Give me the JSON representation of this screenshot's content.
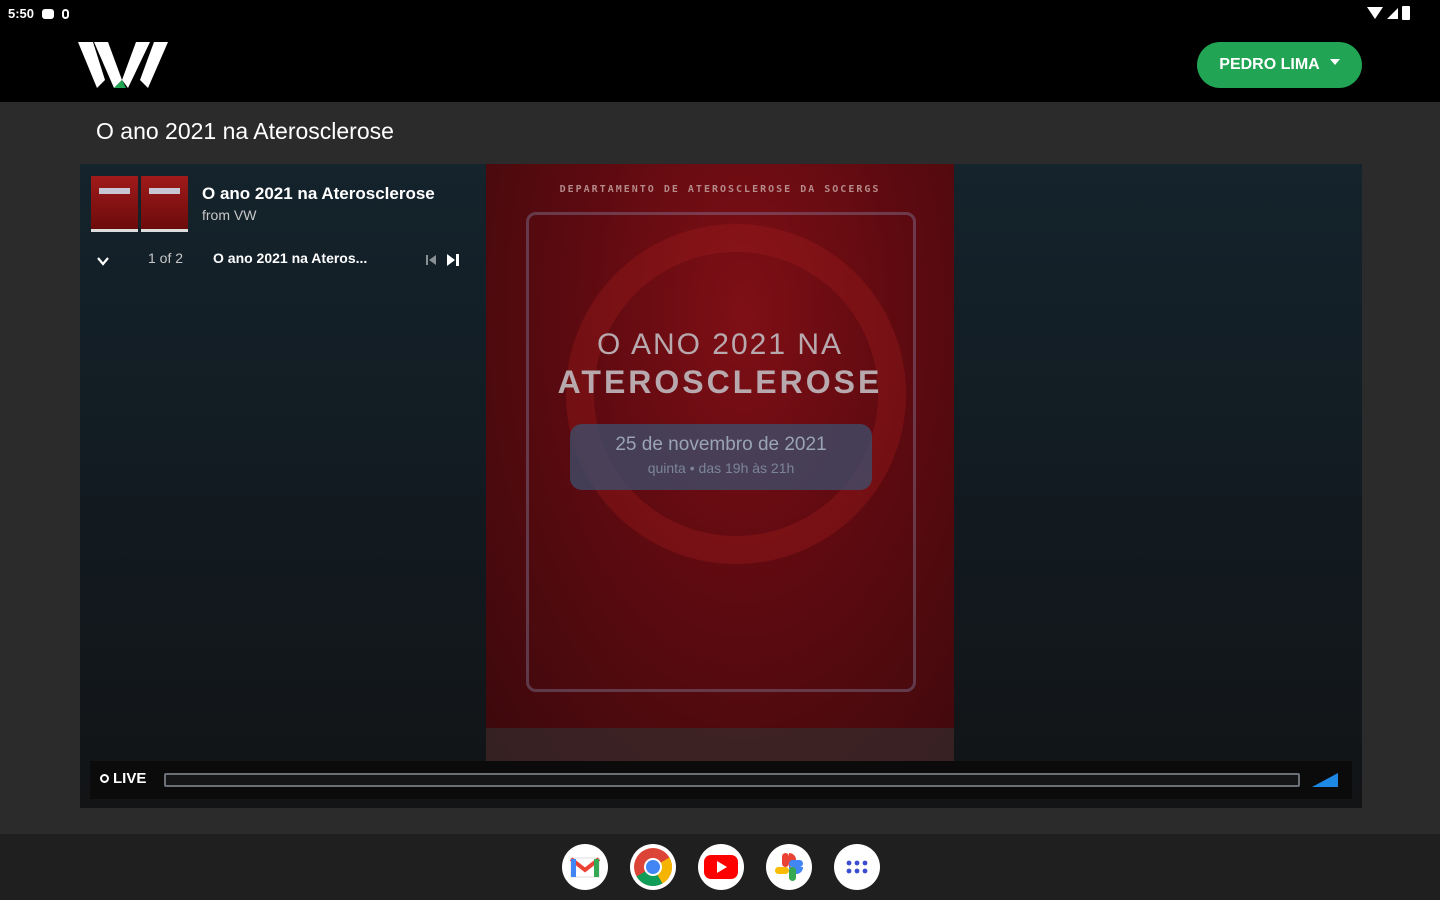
{
  "status_bar": {
    "time": "5:50"
  },
  "header": {
    "user_button_label": "PEDRO LIMA"
  },
  "page": {
    "title": "O ano 2021 na Aterosclerose"
  },
  "playlist": {
    "title": "O ano 2021 na Aterosclerose",
    "from": "from VW",
    "position": "1 of 2",
    "current_item": "O ano 2021 na Ateros..."
  },
  "poster": {
    "department": "DEPARTAMENTO DE ATEROSCLEROSE DA SOCERGS",
    "title_line1": "O ANO 2021 NA",
    "title_line2": "ATEROSCLEROSE",
    "date": "25 de novembro de 2021",
    "time": "quinta • das 19h às 21h"
  },
  "controls": {
    "live_label": "LIVE"
  },
  "dock": {
    "apps": [
      "gmail-icon",
      "chrome-icon",
      "youtube-icon",
      "photos-icon",
      "app-drawer-icon"
    ]
  },
  "colors": {
    "accent_green": "#21a454",
    "header_bg": "#000000",
    "page_bg": "#2b2b2b"
  }
}
